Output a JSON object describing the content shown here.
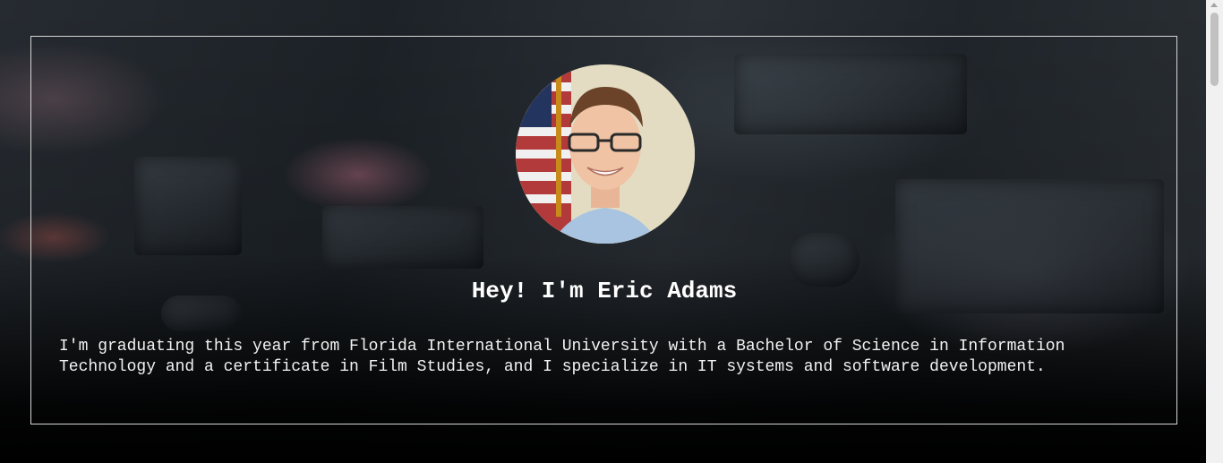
{
  "hero": {
    "heading": "Hey! I'm Eric Adams",
    "bio": "I'm graduating this year from Florida International University with a Bachelor of Science in Information Technology and a certificate in Film Studies, and I specialize in IT systems and software development.",
    "background_image": "circuit-board-photo",
    "profile_photo": "profile-photo-eric-adams"
  },
  "colors": {
    "page_background": "#000000",
    "text": "#ffffff",
    "frame_border": "#d6d6d6",
    "avatar_background": "#e3dcc2",
    "scrollbar_track": "#f1f1f1",
    "scrollbar_thumb": "#c1c1c1"
  }
}
